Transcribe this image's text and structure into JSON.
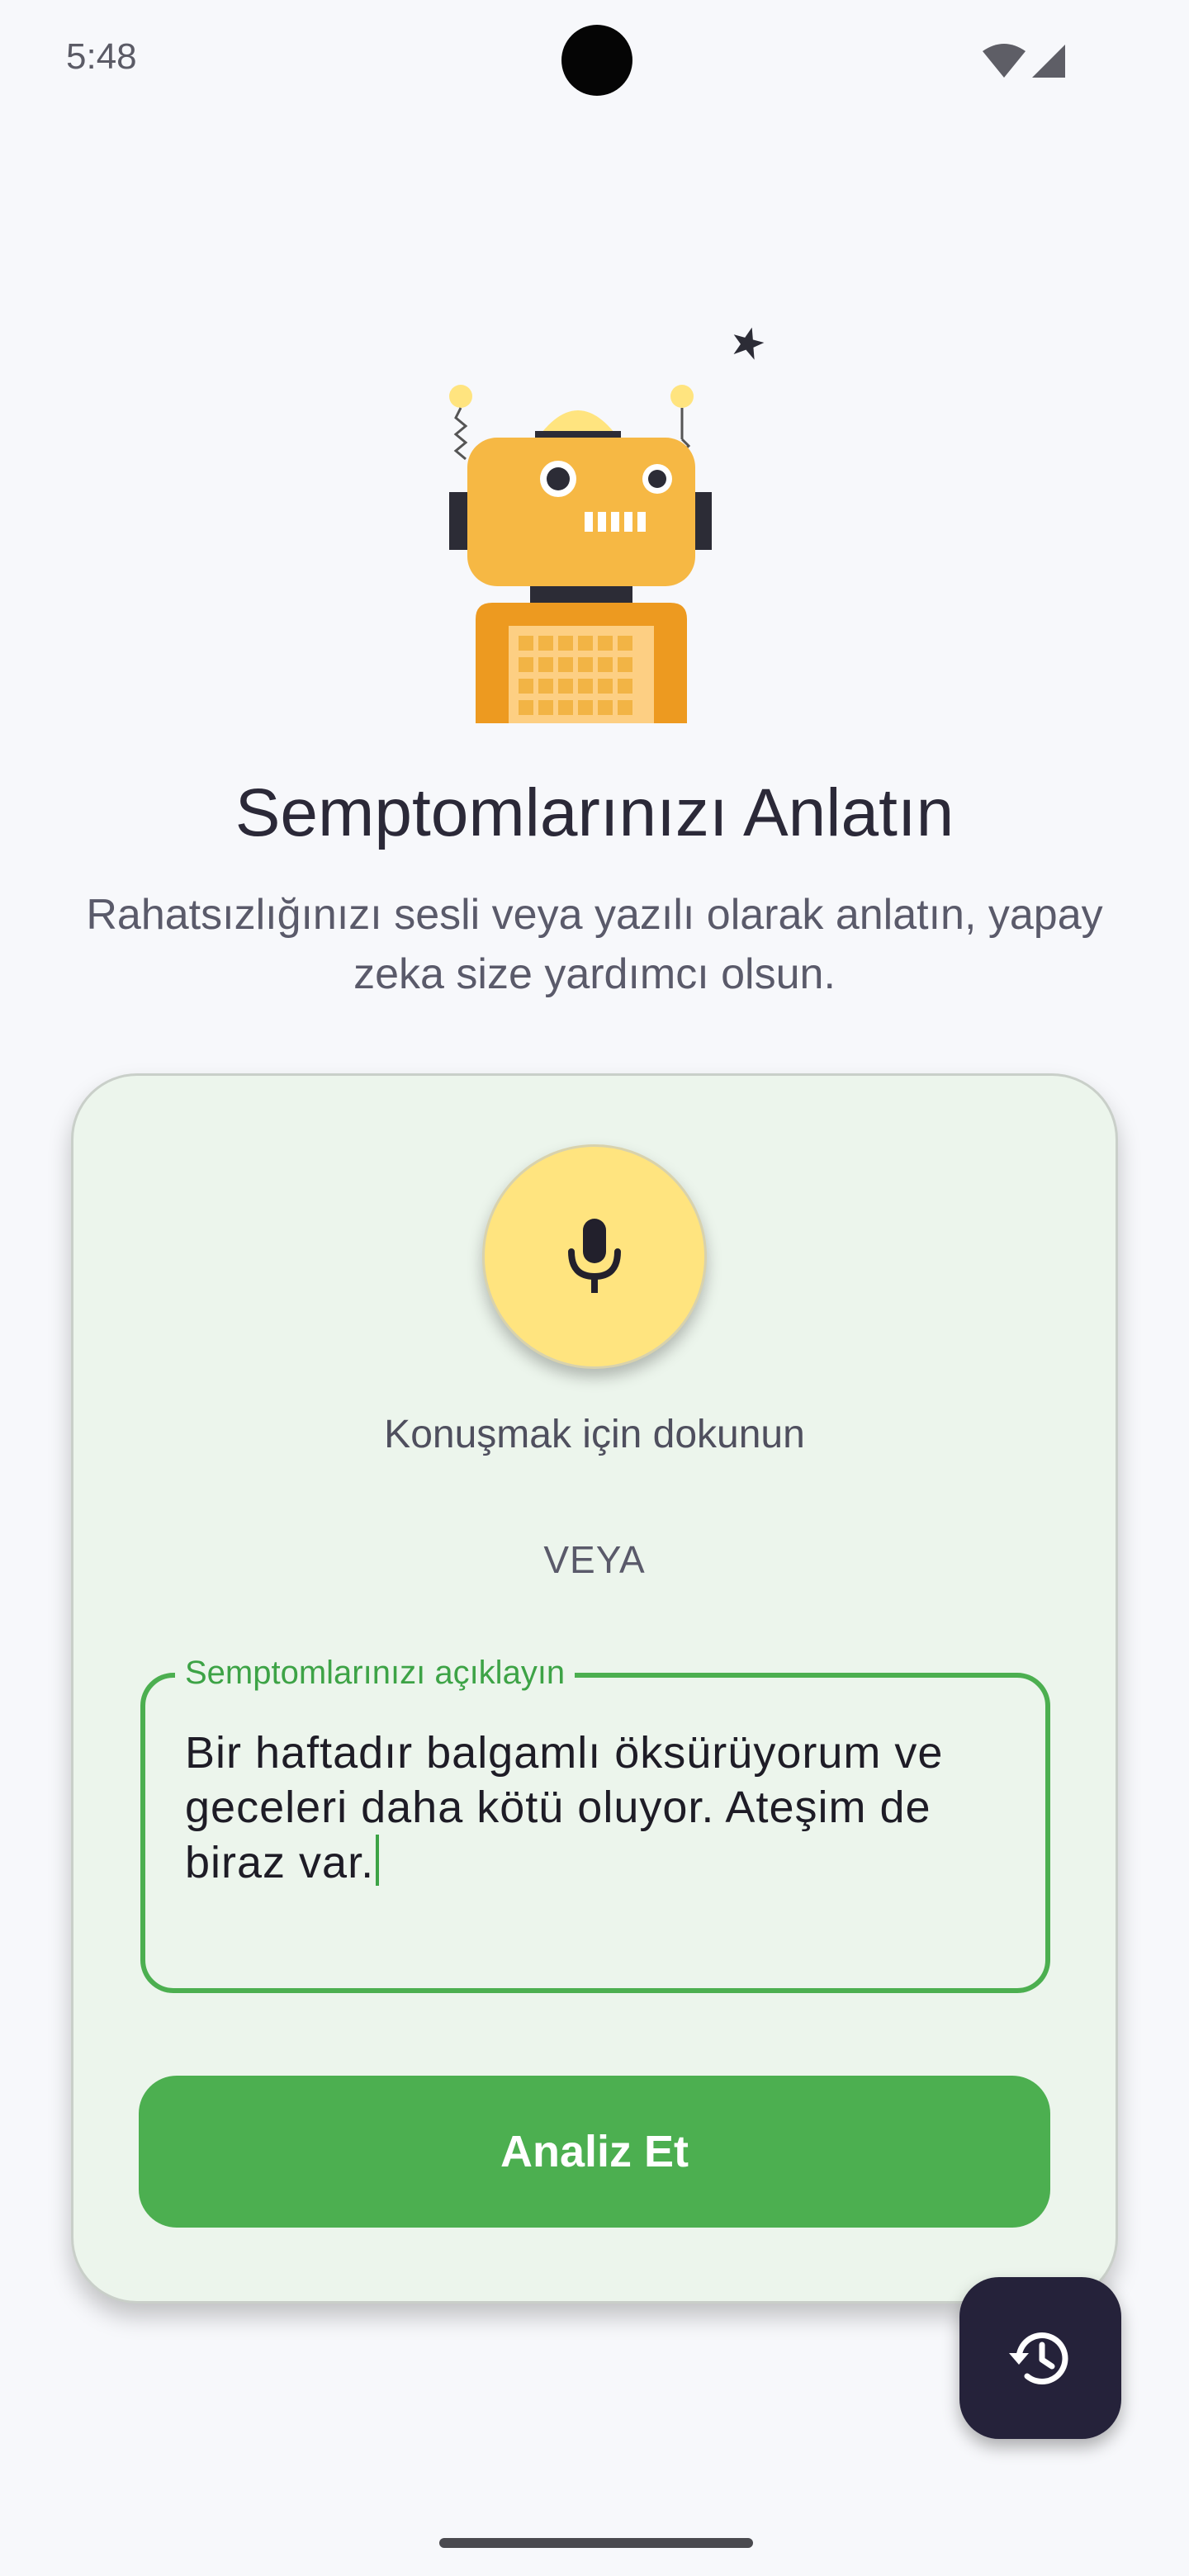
{
  "status_bar": {
    "time": "5:48"
  },
  "hero": {
    "title": "Semptomlarınızı Anlatın",
    "subtitle": "Rahatsızlığınızı sesli veya yazılı olarak anlatın, yapay zeka size yardımcı olsun."
  },
  "card": {
    "mic_hint": "Konuşmak için dokunun",
    "divider_text": "VEYA",
    "input": {
      "label": "Semptomlarınızı açıklayın",
      "value": "Bir haftadır balgamlı öksürüyorum ve geceleri daha kötü oluyor. Ateşim de biraz var."
    },
    "analyze_label": "Analiz Et"
  },
  "icons": {
    "mic": "microphone-icon",
    "history": "history-icon",
    "wifi": "wifi-icon",
    "signal": "cell-signal-icon",
    "illustration": "robot-illustration"
  },
  "colors": {
    "accent_green": "#4caf50",
    "mic_yellow": "#ffe47f",
    "fab_dark": "#25223a",
    "card_bg": "#ecf5ec"
  }
}
